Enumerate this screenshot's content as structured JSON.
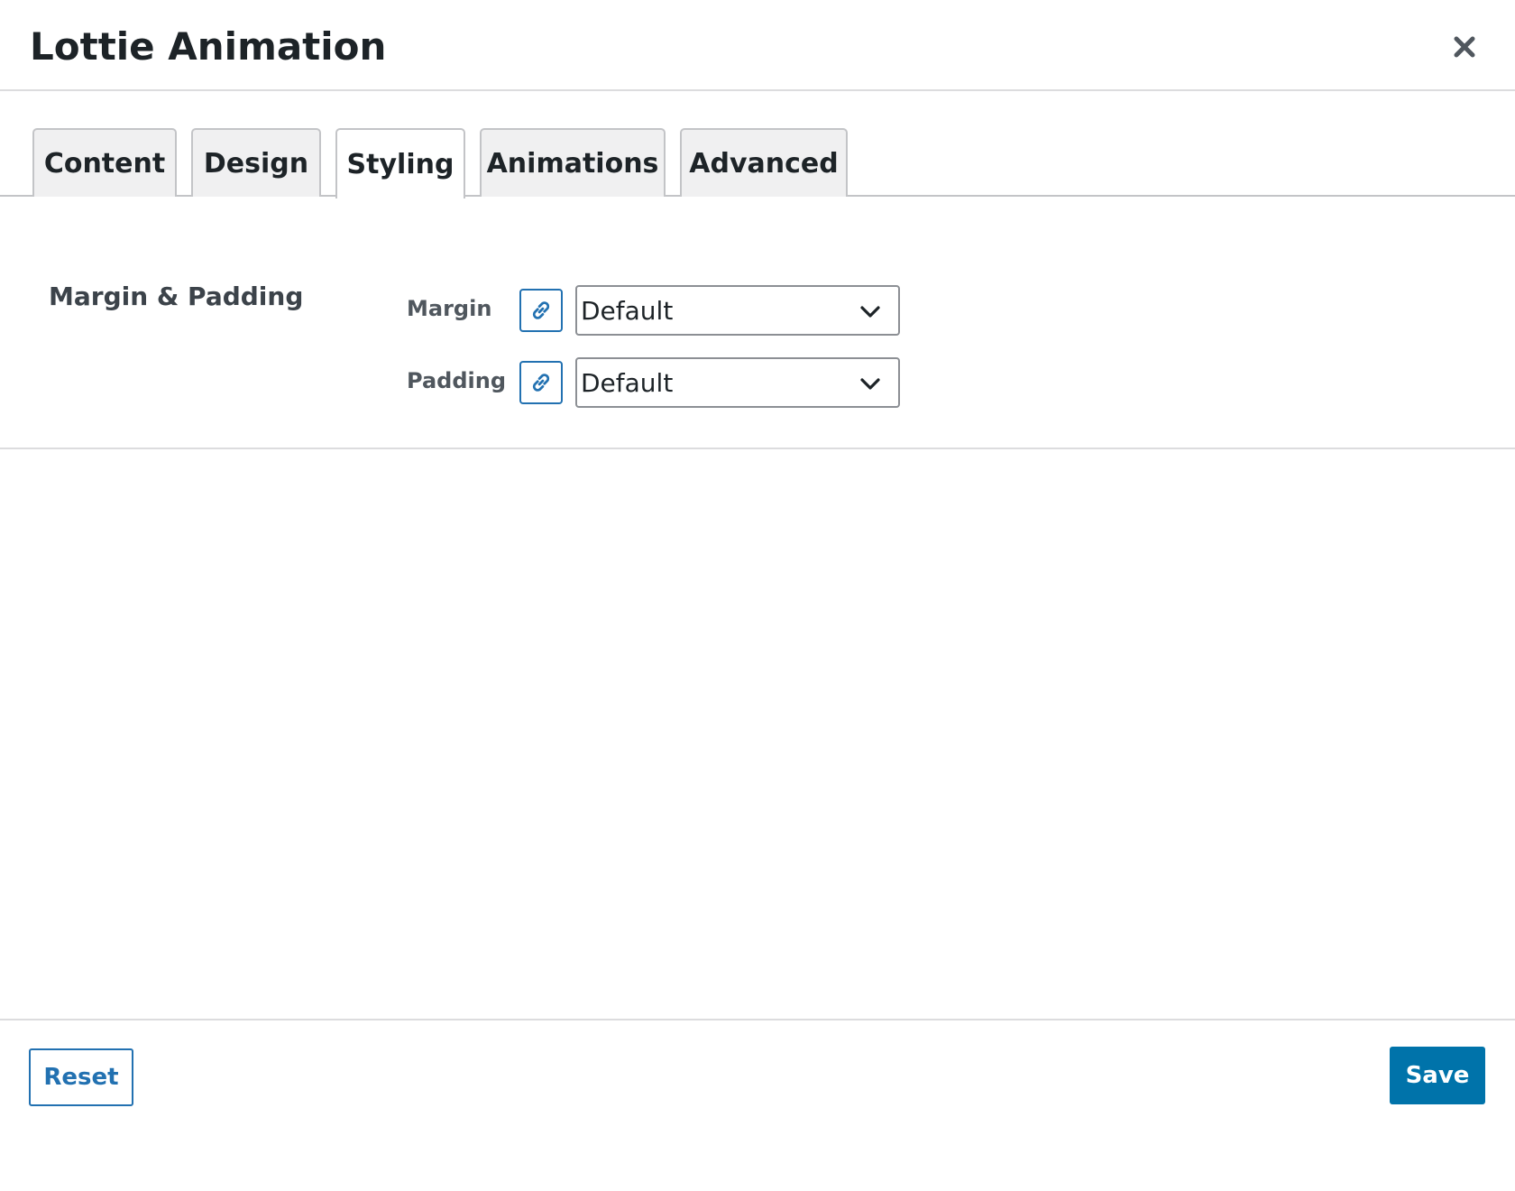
{
  "dialog": {
    "title": "Lottie Animation",
    "close_icon": "close-icon"
  },
  "tabs": [
    {
      "label": "Content",
      "active": false
    },
    {
      "label": "Design",
      "active": false
    },
    {
      "label": "Styling",
      "active": true
    },
    {
      "label": "Animations",
      "active": false
    },
    {
      "label": "Advanced",
      "active": false
    }
  ],
  "section": {
    "title": "Margin & Padding",
    "fields": [
      {
        "label": "Margin",
        "link_icon": "link-icon",
        "value": "Default",
        "chevron_icon": "chevron-down-icon"
      },
      {
        "label": "Padding",
        "link_icon": "link-icon",
        "value": "Default",
        "chevron_icon": "chevron-down-icon"
      }
    ]
  },
  "footer": {
    "reset_label": "Reset",
    "save_label": "Save"
  },
  "colors": {
    "accent": "#2271b1",
    "primary_button": "#0073aa",
    "tab_inactive_bg": "#f0f0f1",
    "border": "#c3c4c7"
  }
}
